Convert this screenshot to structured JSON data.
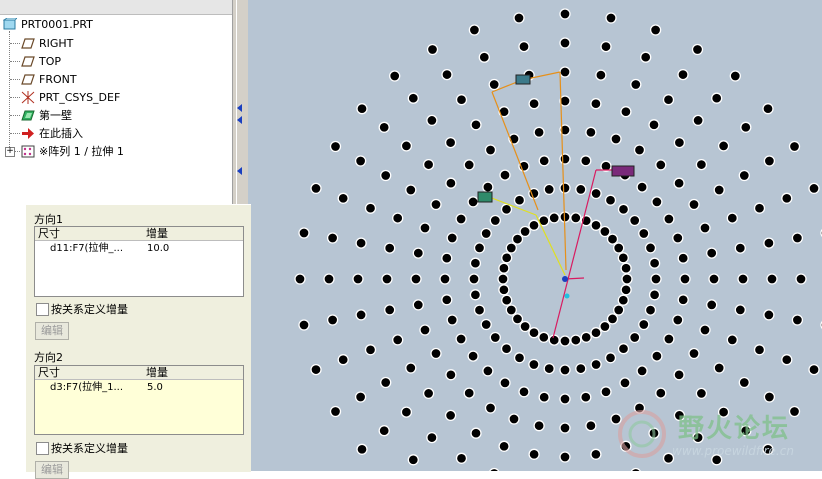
{
  "tree": {
    "root": "PRT0001.PRT",
    "items": [
      {
        "label": "RIGHT",
        "icon": "datum-plane-icon"
      },
      {
        "label": "TOP",
        "icon": "datum-plane-icon"
      },
      {
        "label": "FRONT",
        "icon": "datum-plane-icon"
      },
      {
        "label": "PRT_CSYS_DEF",
        "icon": "coordinate-system-icon"
      },
      {
        "label": "第一壁",
        "icon": "feature-icon"
      },
      {
        "label": "在此插入",
        "icon": "insert-here-arrow-icon"
      },
      {
        "label": "※阵列 1 / 拉伸 1",
        "icon": "pattern-icon"
      }
    ]
  },
  "panel": {
    "direction1": {
      "title": "方向1",
      "col_dim": "尺寸",
      "col_inc": "增量",
      "rows": [
        {
          "dim": "d11:F7(拉伸_...",
          "inc": "10.0"
        }
      ],
      "relation_label": "按关系定义增量",
      "edit_label": "编辑"
    },
    "direction2": {
      "title": "方向2",
      "col_dim": "尺寸",
      "col_inc": "增量",
      "rows": [
        {
          "dim": "d3:F7(拉伸_1...",
          "inc": "5.0"
        }
      ],
      "relation_label": "按关系定义增量",
      "edit_label": "编辑"
    }
  },
  "watermark": {
    "title": "野火论坛",
    "url": "www.proewildfire.cn"
  },
  "colors": {
    "viewport_bg": "#b7c5d3",
    "panel_bg": "#efefde",
    "accent_blue": "#1a3fbf",
    "handle_orange": "#e6901a",
    "handle_magenta": "#d81b60",
    "handle_yellow": "#e0e020"
  }
}
